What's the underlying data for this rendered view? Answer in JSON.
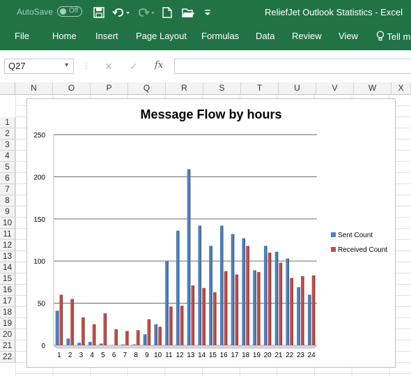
{
  "titlebar": {
    "autosave_label": "AutoSave",
    "autosave_state": "Off",
    "window_title": "ReliefJet Outlook Statistics  -  Excel",
    "icons": [
      "save-icon",
      "undo-icon",
      "redo-icon",
      "new-file-icon",
      "open-folder-icon",
      "customize-qat-icon"
    ]
  },
  "ribbon": {
    "tabs": [
      "File",
      "Home",
      "Insert",
      "Page Layout",
      "Formulas",
      "Data",
      "Review",
      "View"
    ],
    "tell_me": "Tell m"
  },
  "formula_bar": {
    "name_box": "Q27",
    "fx_label": "fx",
    "value": ""
  },
  "sheet": {
    "columns": [
      "N",
      "O",
      "P",
      "Q",
      "R",
      "S",
      "T",
      "U",
      "V",
      "W",
      "X"
    ],
    "rows": [
      "1",
      "2",
      "3",
      "4",
      "5",
      "6",
      "7",
      "8",
      "9",
      "10",
      "11",
      "12",
      "13",
      "14",
      "15",
      "16",
      "17",
      "18",
      "19",
      "20",
      "21",
      "22"
    ]
  },
  "chart_data": {
    "type": "bar",
    "title": "Message Flow by hours",
    "xlabel": "",
    "ylabel": "",
    "ylim": [
      0,
      250
    ],
    "yticks": [
      "0",
      "50",
      "100",
      "150",
      "200",
      "250"
    ],
    "grid": true,
    "legend_position": "right",
    "categories": [
      "1",
      "2",
      "3",
      "4",
      "5",
      "6",
      "7",
      "8",
      "9",
      "10",
      "11",
      "12",
      "13",
      "14",
      "15",
      "16",
      "17",
      "18",
      "19",
      "20",
      "21",
      "22",
      "23",
      "24"
    ],
    "series": [
      {
        "name": "Sent Count",
        "color": "#4f81bd",
        "values": [
          41,
          8,
          3,
          4,
          2,
          0,
          1,
          1,
          13,
          25,
          100,
          136,
          209,
          142,
          118,
          142,
          132,
          127,
          89,
          118,
          111,
          103,
          69,
          60
        ]
      },
      {
        "name": "Received Count",
        "color": "#c0504d",
        "values": [
          60,
          55,
          33,
          25,
          38,
          19,
          17,
          18,
          31,
          22,
          46,
          47,
          71,
          68,
          63,
          88,
          84,
          118,
          87,
          110,
          98,
          80,
          82,
          83
        ]
      }
    ]
  }
}
